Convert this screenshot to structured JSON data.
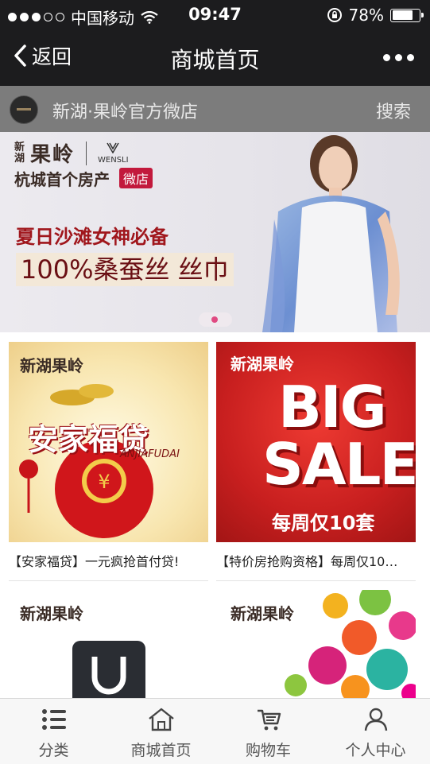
{
  "status": {
    "carrier": "中国移动",
    "time": "09:47",
    "battery": "78%",
    "battery_fill": 0.78
  },
  "nav": {
    "back_label": "返回",
    "title": "商城首页"
  },
  "store": {
    "name": "新湖·果岭官方微店",
    "search_label": "搜索"
  },
  "banner": {
    "brand_small": "新湖",
    "brand_big": "果岭",
    "partner": "WENSLI",
    "line1": "杭城首个房产",
    "tag": "微店",
    "headline": "夏日沙滩女神必备",
    "subline": "100%桑蚕丝 丝巾"
  },
  "products": [
    {
      "caption": "【安家福贷】一元疯抢首付贷!",
      "img_title": "安家福贷",
      "img_sub": "ANJIAFUDAI",
      "img_logo": "新湖果岭"
    },
    {
      "caption": "【特价房抢购资格】每周仅10…",
      "img_big1": "BIG",
      "img_big2": "SALE",
      "img_sub": "每周仅10套",
      "img_logo": "新湖果岭"
    },
    {
      "caption": "",
      "img_logo": "新湖果岭"
    },
    {
      "caption": "",
      "img_logo": "新湖果岭"
    }
  ],
  "tabs": [
    {
      "label": "分类",
      "icon": "list-icon"
    },
    {
      "label": "商城首页",
      "icon": "home-icon"
    },
    {
      "label": "购物车",
      "icon": "cart-icon"
    },
    {
      "label": "个人中心",
      "icon": "user-icon"
    }
  ],
  "colors": {
    "accent": "#c2193c",
    "bar": "#1c1c1e",
    "storebar": "#7c7c7c"
  }
}
